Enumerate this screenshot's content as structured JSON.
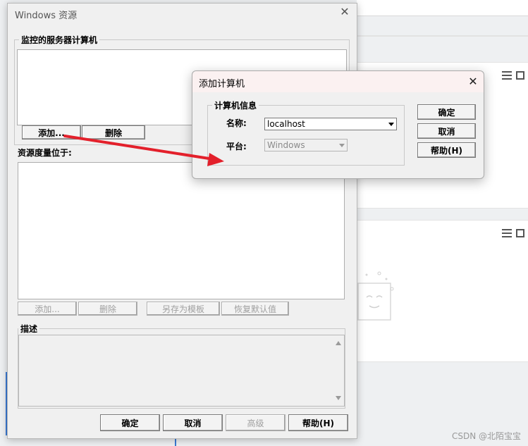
{
  "main_dialog": {
    "title": "Windows 资源",
    "monitored_group": "监控的服务器计算机",
    "add_label": "添加...",
    "delete_label": "删除",
    "resource_measure_label": "资源度量位于:",
    "resource_add": "添加...",
    "resource_delete": "删除",
    "save_as_template": "另存为模板",
    "restore_defaults": "恢复默认值",
    "description_group": "描述",
    "ok": "确定",
    "cancel": "取消",
    "advanced": "高级",
    "help": "帮助(H)"
  },
  "add_dialog": {
    "title": "添加计算机",
    "info_group": "计算机信息",
    "name_label": "名称:",
    "name_value": "localhost",
    "platform_label": "平台:",
    "platform_value": "Windows",
    "ok": "确定",
    "cancel": "取消",
    "help": "帮助(H)"
  },
  "watermark": "CSDN @北陌宝宝",
  "annotation_arrow_color": "#e3202b"
}
